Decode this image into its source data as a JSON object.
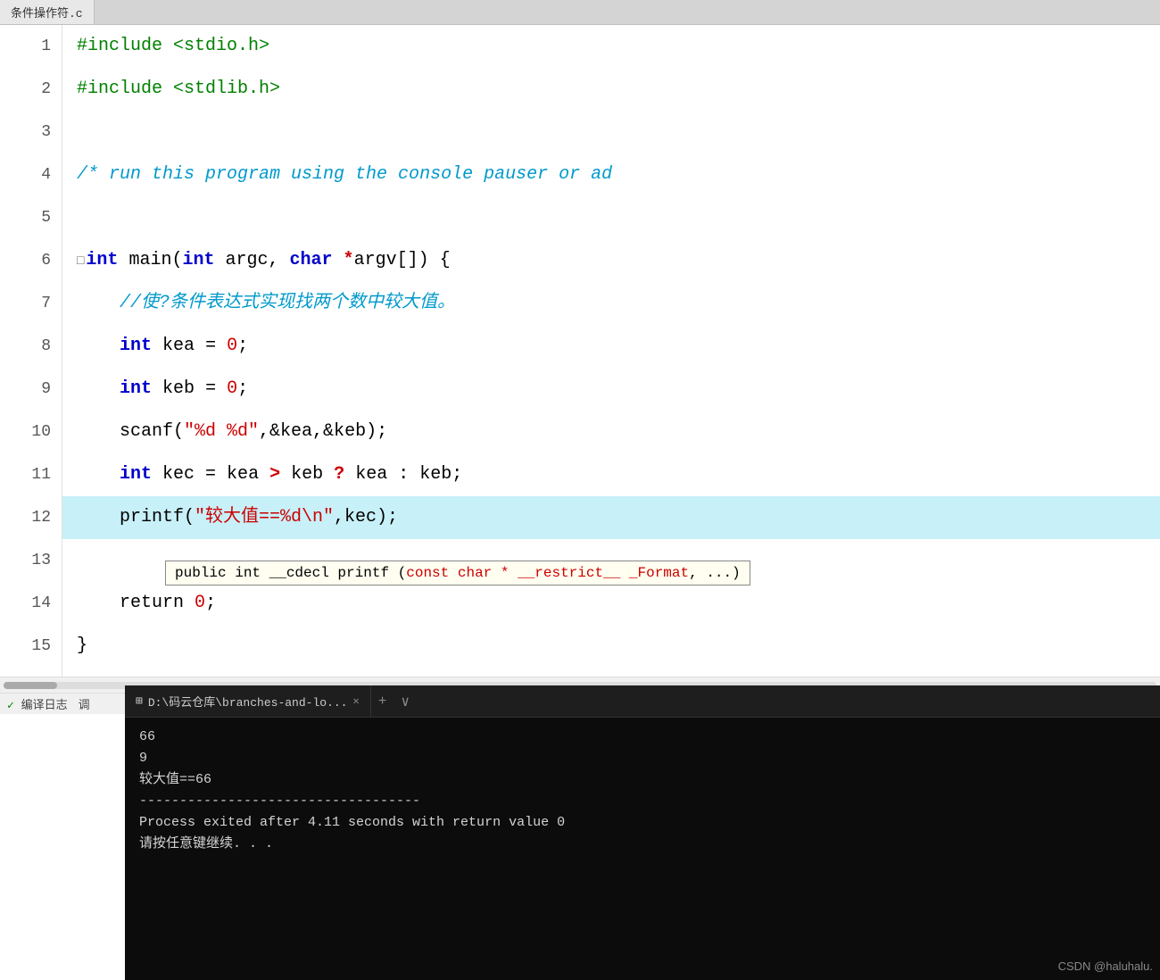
{
  "tab": {
    "label": "条件操作符.c"
  },
  "editor": {
    "lines": [
      {
        "num": "1",
        "content_html": "<span class='include-kw'>#include</span> <span class='include-path'>&lt;stdio.h&gt;</span>",
        "highlighted": false
      },
      {
        "num": "2",
        "content_html": "<span class='include-kw'>#include</span> <span class='include-path'>&lt;stdlib.h&gt;</span>",
        "highlighted": false
      },
      {
        "num": "3",
        "content_html": "",
        "highlighted": false
      },
      {
        "num": "4",
        "content_html": "<span class='comment'>/* run this program using the console pauser or ad</span>",
        "highlighted": false
      },
      {
        "num": "5",
        "content_html": "",
        "highlighted": false
      },
      {
        "num": "6",
        "content_html": "<span class='kw'>int</span> <span class='plain'>main(</span><span class='kw'>int</span> <span class='plain'>argc,</span> <span class='kw'>char</span> <span class='operator'>*</span><span class='plain'>argv[]) {</span>",
        "highlighted": false,
        "collapse": true
      },
      {
        "num": "7",
        "content_html": "&nbsp;&nbsp;&nbsp;&nbsp;<span class='comment'>//使?条件表达式实现找两个数中较大值。</span>",
        "highlighted": false
      },
      {
        "num": "8",
        "content_html": "&nbsp;&nbsp;&nbsp;&nbsp;<span class='kw'>int</span> <span class='plain'>kea</span> <span class='plain'>=</span> <span class='number'>0</span><span class='plain'>;</span>",
        "highlighted": false
      },
      {
        "num": "9",
        "content_html": "&nbsp;&nbsp;&nbsp;&nbsp;<span class='kw'>int</span> <span class='plain'>keb</span> <span class='plain'>=</span> <span class='number'>0</span><span class='plain'>;</span>",
        "highlighted": false
      },
      {
        "num": "10",
        "content_html": "&nbsp;&nbsp;&nbsp;&nbsp;<span class='plain'>scanf(</span><span class='string'>\"%d %d\"</span><span class='plain'>,&amp;kea,&amp;keb);</span>",
        "highlighted": false
      },
      {
        "num": "11",
        "content_html": "&nbsp;&nbsp;&nbsp;&nbsp;<span class='kw'>int</span> <span class='plain'>kec = kea</span> <span class='operator'>&gt;</span> <span class='plain'>keb</span> <span class='operator'>?</span> <span class='plain'>kea : keb;</span>",
        "highlighted": false
      },
      {
        "num": "12",
        "content_html": "&nbsp;&nbsp;&nbsp;&nbsp;<span class='plain'>printf(</span><span class='string'>\"较大值==%d\\n\"</span><span class='plain'>,kec);</span>",
        "highlighted": true
      },
      {
        "num": "13",
        "content_html": "",
        "highlighted": false,
        "tooltip": true
      },
      {
        "num": "14",
        "content_html": "&nbsp;&nbsp;&nbsp;&nbsp;<span class='plain'>return</span> <span class='number'>0</span><span class='plain'>;</span>",
        "highlighted": false
      },
      {
        "num": "15",
        "content_html": "<span class='plain'>}</span>",
        "highlighted": false
      }
    ],
    "tooltip": {
      "text_before": "public int __cdecl printf (",
      "type_text": "const char * __restrict__ _Format",
      "text_after": ", ...)"
    }
  },
  "terminal": {
    "tab_label": "D:\\码云仓库\\branches-and-lo...",
    "tab_add": "+",
    "tab_dropdown": "∨",
    "output": [
      "66",
      "9",
      "较大值==66",
      "",
      "-----------------------------------",
      "Process exited after 4.11 seconds with return value 0",
      "请按任意键继续. . ."
    ]
  },
  "status_bar": {
    "item1": "编译日志",
    "item2": "调"
  },
  "csdn": {
    "watermark": "CSDN @haluhalu."
  }
}
